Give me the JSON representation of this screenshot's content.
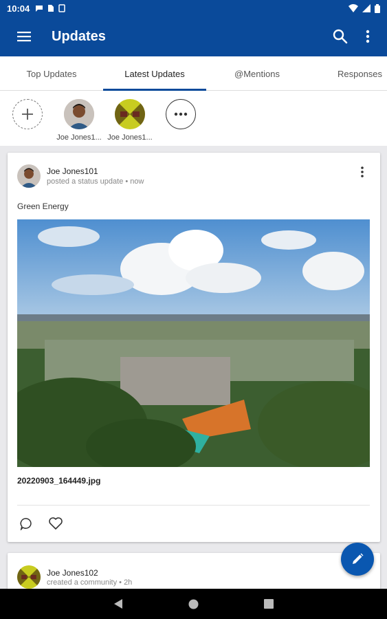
{
  "status_bar": {
    "time": "10:04"
  },
  "app_bar": {
    "title": "Updates",
    "menu_icon": "hamburger-icon",
    "search_icon": "search-icon",
    "more_icon": "more-vert-icon"
  },
  "tabs": [
    {
      "label": "Top Updates"
    },
    {
      "label": "Latest Updates",
      "active": true
    },
    {
      "label": "@Mentions"
    },
    {
      "label": "Responses"
    }
  ],
  "stories": {
    "items": [
      {
        "name": "Joe Jones1..."
      },
      {
        "name": "Joe Jones1..."
      }
    ]
  },
  "posts": [
    {
      "author": "Joe Jones101",
      "action": "posted a status update • now",
      "text": "Green Energy",
      "attachment": "20220903_164449.jpg"
    },
    {
      "author": "Joe Jones102",
      "action": "created a community • 2h"
    }
  ],
  "colors": {
    "primary": "#0a4a9a",
    "fab": "#0a57b0"
  }
}
